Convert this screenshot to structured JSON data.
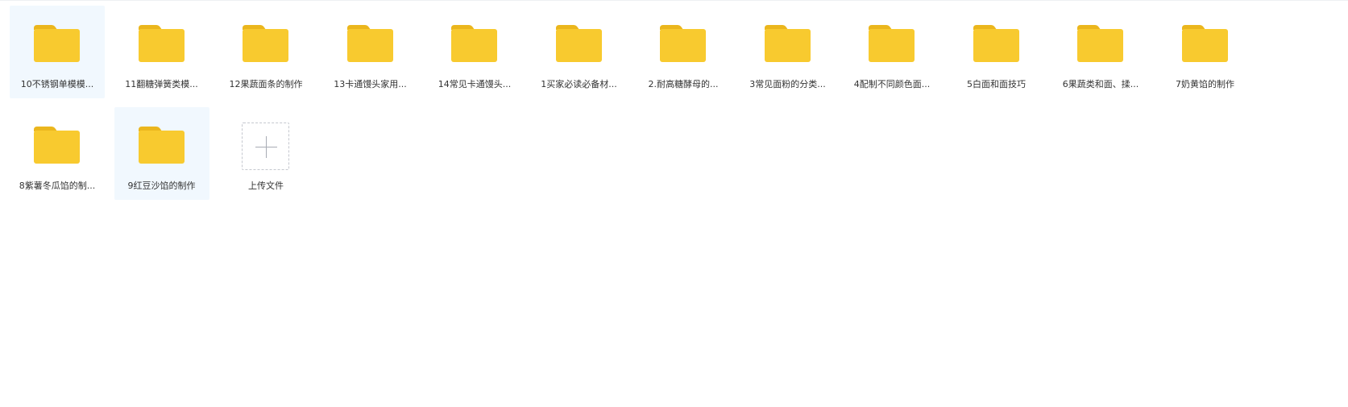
{
  "colors": {
    "folder_body": "#F8CA2F",
    "folder_tab": "#EBB61D",
    "selected_bg": "#F1F8FE",
    "label_text": "#333333"
  },
  "folders": [
    {
      "name": "10不锈钢单模模...",
      "icon": "folder-icon",
      "selected": true
    },
    {
      "name": "11翻糖弹簧类模...",
      "icon": "folder-icon",
      "selected": false
    },
    {
      "name": "12果蔬面条的制作",
      "icon": "folder-icon",
      "selected": false
    },
    {
      "name": "13卡通馒头家用...",
      "icon": "folder-icon",
      "selected": false
    },
    {
      "name": "14常见卡通馒头...",
      "icon": "folder-icon",
      "selected": false
    },
    {
      "name": "1买家必读必备材...",
      "icon": "folder-icon",
      "selected": false
    },
    {
      "name": "2.耐高糖酵母的...",
      "icon": "folder-icon",
      "selected": false
    },
    {
      "name": "3常见面粉的分类...",
      "icon": "folder-icon",
      "selected": false
    },
    {
      "name": "4配制不同颜色面...",
      "icon": "folder-icon",
      "selected": false
    },
    {
      "name": "5白面和面技巧",
      "icon": "folder-icon",
      "selected": false
    },
    {
      "name": "6果蔬类和面、揉...",
      "icon": "folder-icon",
      "selected": false
    },
    {
      "name": "7奶黄馅的制作",
      "icon": "folder-icon",
      "selected": false
    },
    {
      "name": "8紫薯冬瓜馅的制...",
      "icon": "folder-icon",
      "selected": false
    },
    {
      "name": "9红豆沙馅的制作",
      "icon": "folder-icon",
      "selected": true
    }
  ],
  "upload": {
    "label": "上传文件",
    "icon": "plus-icon"
  }
}
